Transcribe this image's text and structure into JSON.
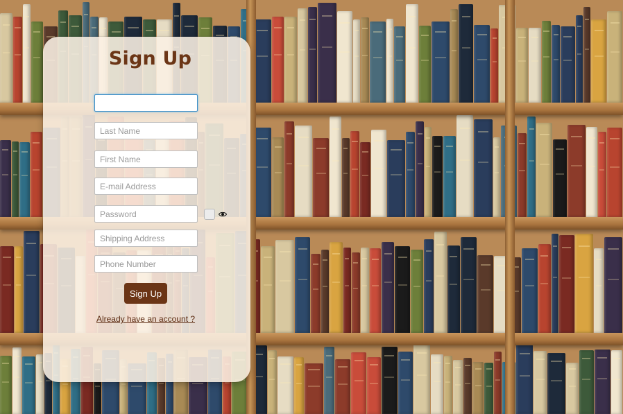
{
  "form": {
    "title": "Sign Up",
    "fields": {
      "username": {
        "value": "",
        "placeholder": ""
      },
      "last_name": {
        "value": "",
        "placeholder": "Last Name"
      },
      "first_name": {
        "value": "",
        "placeholder": "First Name"
      },
      "email": {
        "value": "",
        "placeholder": "E-mail Address"
      },
      "password": {
        "value": "",
        "placeholder": "Password"
      },
      "shipping_address": {
        "value": "",
        "placeholder": "Shipping Address"
      },
      "phone": {
        "value": "",
        "placeholder": "Phone Number"
      }
    },
    "show_password_checked": false,
    "show_password_icon": "eye-icon",
    "submit_label": "Sign Up",
    "login_link": "Already have an account ?"
  },
  "colors": {
    "accent": "#6b3516",
    "card": "#faf0e4",
    "focus": "#3c8fc8"
  }
}
